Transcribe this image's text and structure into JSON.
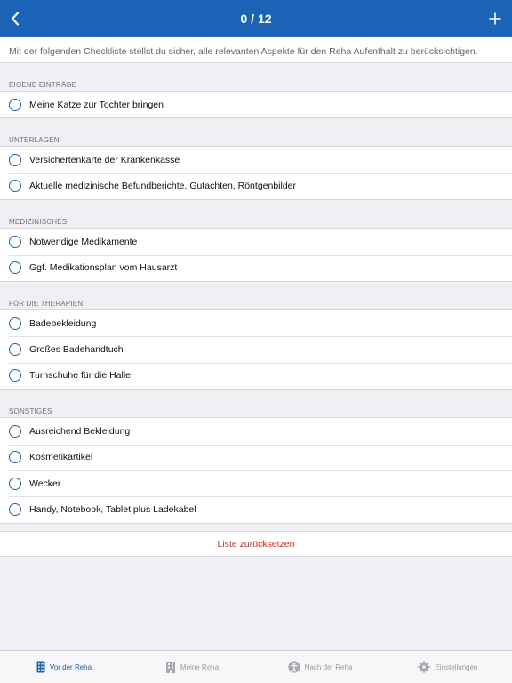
{
  "nav": {
    "title": "0 / 12",
    "back_icon": "chevron-left-icon",
    "add_icon": "plus-icon"
  },
  "intro": "Mit der folgenden Checkliste stellst du sicher, alle relevanten Aspekte für den Reha Aufenthalt zu berücksichtigen.",
  "sections": [
    {
      "header": "EIGENE EINTRÄGE",
      "items": [
        {
          "label": "Meine Katze zur Tochter bringen",
          "checked": false
        }
      ]
    },
    {
      "header": "UNTERLAGEN",
      "items": [
        {
          "label": "Versichertenkarte der Krankenkasse",
          "checked": false
        },
        {
          "label": "Aktuelle medizinische Befundberichte, Gutachten, Röntgenbilder",
          "checked": false
        }
      ]
    },
    {
      "header": "MEDIZINISCHES",
      "items": [
        {
          "label": "Notwendige Medikamente",
          "checked": false
        },
        {
          "label": "Ggf. Medikationsplan vom Hausarzt",
          "checked": false
        }
      ]
    },
    {
      "header": "FÜR DIE THERAPIEN",
      "items": [
        {
          "label": "Badebekleidung",
          "checked": false
        },
        {
          "label": "Großes Badehandtuch",
          "checked": false
        },
        {
          "label": "Turnschuhe für die Halle",
          "checked": false
        }
      ]
    },
    {
      "header": "SONSTIGES",
      "items": [
        {
          "label": "Ausreichend Bekleidung",
          "checked": false
        },
        {
          "label": "Kosmetikartikel",
          "checked": false
        },
        {
          "label": "Wecker",
          "checked": false
        },
        {
          "label": "Handy, Notebook, Tablet plus Ladekabel",
          "checked": false
        }
      ]
    }
  ],
  "reset_label": "Liste zurücksetzen",
  "tabs": [
    {
      "label": "Vor der Reha",
      "icon": "checklist-icon",
      "active": true
    },
    {
      "label": "Meine Reha",
      "icon": "building-icon",
      "active": false
    },
    {
      "label": "Nach der Reha",
      "icon": "person-icon",
      "active": false
    },
    {
      "label": "Einstellungen",
      "icon": "gear-icon",
      "active": false
    }
  ],
  "colors": {
    "accent": "#1a63b7",
    "reset": "#e0301e",
    "background": "#efeff4"
  }
}
